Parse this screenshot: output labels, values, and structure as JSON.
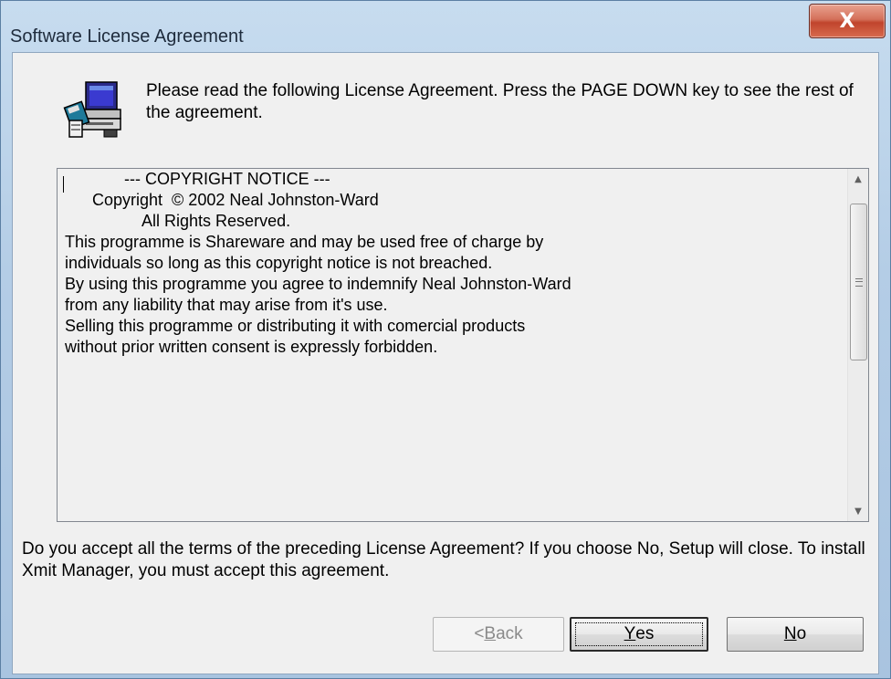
{
  "window": {
    "title": "Software License Agreement",
    "close_glyph": "X"
  },
  "intro": {
    "icon": "setup-computer-icon",
    "text": "Please read the following License Agreement.  Press the PAGE DOWN key to see the rest of the agreement."
  },
  "license": {
    "lines": [
      "",
      "             --- COPYRIGHT NOTICE ---",
      "",
      "      Copyright  © 2002 Neal Johnston-Ward",
      "                 All Rights Reserved.",
      "",
      "This programme is Shareware and may be used free of charge by",
      "individuals so long as this copyright notice is not breached.",
      "",
      "By using this programme you agree to indemnify Neal Johnston-Ward",
      "from any liability that may arise from it's use.",
      "",
      "Selling this programme or distributing it with comercial products",
      "without prior written consent is expressly forbidden."
    ],
    "scroll_position": 0.0
  },
  "question": {
    "text": "Do you accept all the terms of the preceding License Agreement?  If you choose No,  Setup will close.  To install Xmit Manager, you must accept this agreement."
  },
  "buttons": {
    "back": {
      "prefix": "< ",
      "mnemonic": "B",
      "rest": "ack",
      "enabled": false
    },
    "yes": {
      "mnemonic": "Y",
      "rest": "es",
      "default": true
    },
    "no": {
      "mnemonic": "N",
      "rest": "o"
    }
  },
  "colors": {
    "close_button": "#c7452e",
    "frame": "#b4cde6",
    "dialog_bg": "#f0f0f0"
  }
}
